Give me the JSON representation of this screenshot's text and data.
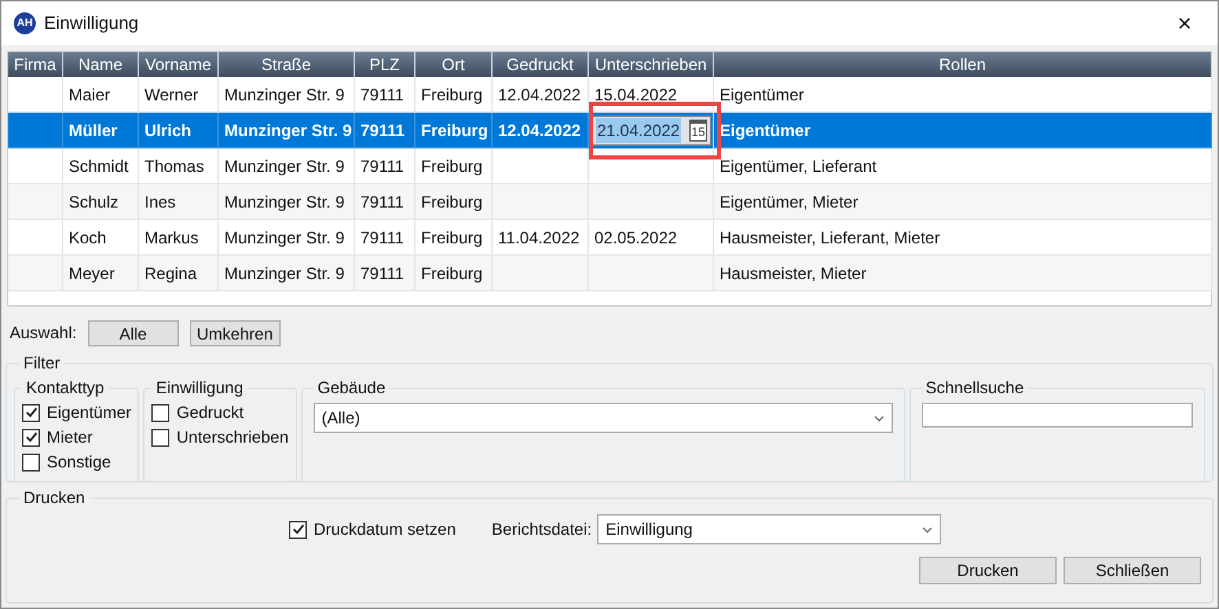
{
  "window": {
    "title": "Einwilligung",
    "icon_text": "AH",
    "close": "×"
  },
  "table": {
    "columns": [
      "Firma",
      "Name",
      "Vorname",
      "Straße",
      "PLZ",
      "Ort",
      "Gedruckt",
      "Unterschrieben",
      "Rollen"
    ],
    "rows": [
      {
        "selected": false,
        "editing": false,
        "name": "Maier",
        "vorname": "Werner",
        "strasse": "Munzinger Str. 9",
        "plz": "79111",
        "ort": "Freiburg",
        "gedruckt": "12.04.2022",
        "unterschrieben": "15.04.2022",
        "rollen": "Eigentümer"
      },
      {
        "selected": true,
        "editing": true,
        "name": "Müller",
        "vorname": "Ulrich",
        "strasse": "Munzinger Str. 9",
        "plz": "79111",
        "ort": "Freiburg",
        "gedruckt": "12.04.2022",
        "unterschrieben": "21.04.2022",
        "calendar_day": "15",
        "rollen": "Eigentümer"
      },
      {
        "selected": false,
        "editing": false,
        "name": "Schmidt",
        "vorname": "Thomas",
        "strasse": "Munzinger Str. 9",
        "plz": "79111",
        "ort": "Freiburg",
        "rollen": "Eigentümer, Lieferant"
      },
      {
        "selected": false,
        "editing": false,
        "name": "Schulz",
        "vorname": "Ines",
        "strasse": "Munzinger Str. 9",
        "plz": "79111",
        "ort": "Freiburg",
        "rollen": "Eigentümer, Mieter"
      },
      {
        "selected": false,
        "editing": false,
        "name": "Koch",
        "vorname": "Markus",
        "strasse": "Munzinger Str. 9",
        "plz": "79111",
        "ort": "Freiburg",
        "gedruckt": "11.04.2022",
        "unterschrieben": "02.05.2022",
        "rollen": "Hausmeister, Lieferant, Mieter"
      },
      {
        "selected": false,
        "editing": false,
        "name": "Meyer",
        "vorname": "Regina",
        "strasse": "Munzinger Str. 9",
        "plz": "79111",
        "ort": "Freiburg",
        "rollen": "Hausmeister, Mieter"
      }
    ]
  },
  "selection": {
    "label": "Auswahl:",
    "buttons": [
      "Alle",
      "Umkehren"
    ]
  },
  "filter": {
    "title": "Filter",
    "kontakttyp": {
      "title": "Kontakttyp",
      "items": [
        {
          "label": "Eigentümer",
          "checked": true
        },
        {
          "label": "Mieter",
          "checked": true
        },
        {
          "label": "Sonstige",
          "checked": false
        }
      ]
    },
    "einwilligung": {
      "title": "Einwilligung",
      "items": [
        {
          "label": "Gedruckt",
          "checked": false
        },
        {
          "label": "Unterschrieben",
          "checked": false
        }
      ]
    },
    "gebaeude": {
      "title": "Gebäude",
      "value": "(Alle)"
    },
    "schnellsuche": {
      "title": "Schnellsuche"
    }
  },
  "print": {
    "title": "Drucken",
    "set_date": {
      "label": "Druckdatum setzen",
      "checked": true
    },
    "report_label": "Berichtsdatei:",
    "report_value": "Einwilligung",
    "buttons": [
      "Drucken",
      "Schließen"
    ]
  }
}
